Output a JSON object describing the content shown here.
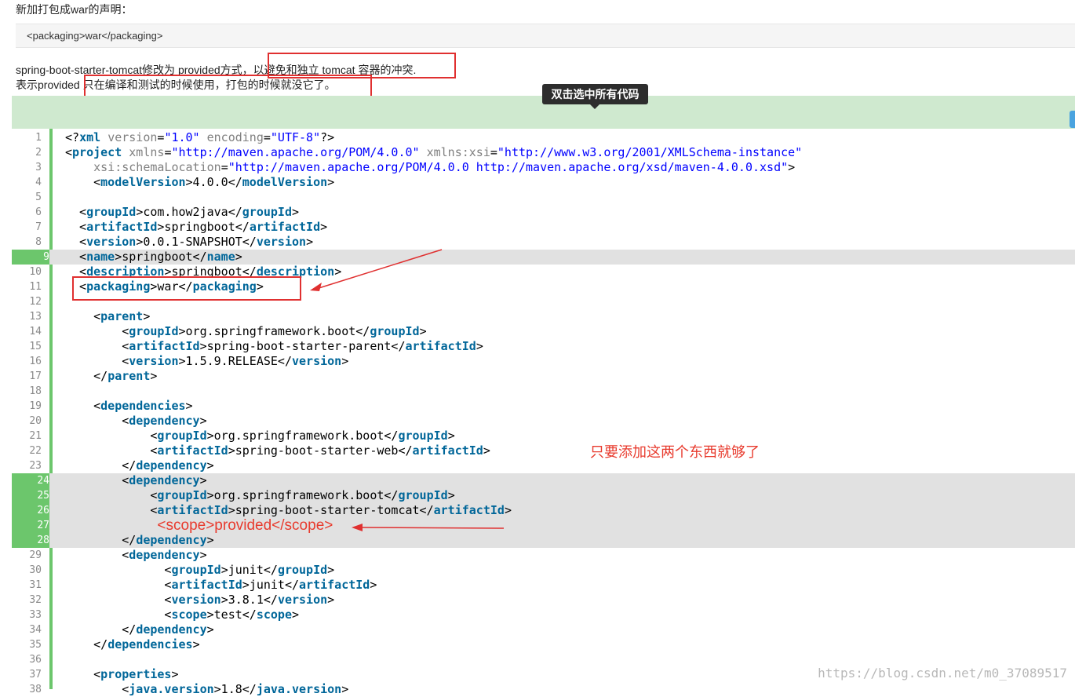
{
  "intro": {
    "heading": "新加打包成war的声明：",
    "snippet": "<packaging>war</packaging>",
    "desc1_prefix": "spring-boot-starter-tomcat修改为 provided方式，",
    "desc1_box": "以避免和独立 tomcat 容器的冲突.",
    "desc2_prefix": "表示provided ",
    "desc2_box": "只在编译和测试的时候使用，打包的时候就没它了。"
  },
  "tooltip": "双击选中所有代码",
  "note": "只要添加这两个东西就够了",
  "watermark": "https://blog.csdn.net/m0_37089517",
  "code": {
    "line_numbers": [
      "1",
      "2",
      "3",
      "4",
      "5",
      "6",
      "7",
      "8",
      "9",
      "10",
      "11",
      "12",
      "13",
      "14",
      "15",
      "16",
      "17",
      "18",
      "19",
      "20",
      "21",
      "22",
      "23",
      "24",
      "25",
      "26",
      "27",
      "28",
      "29",
      "30",
      "31",
      "32",
      "33",
      "34",
      "35",
      "36",
      "37",
      "38"
    ],
    "lines": [
      "<?xml version=\"1.0\" encoding=\"UTF-8\"?>",
      "<project xmlns=\"http://maven.apache.org/POM/4.0.0\" xmlns:xsi=\"http://www.w3.org/2001/XMLSchema-instance\"",
      "    xsi:schemaLocation=\"http://maven.apache.org/POM/4.0.0 http://maven.apache.org/xsd/maven-4.0.0.xsd\">",
      "    <modelVersion>4.0.0</modelVersion>",
      "",
      "  <groupId>com.how2java</groupId>",
      "  <artifactId>springboot</artifactId>",
      "  <version>0.0.1-SNAPSHOT</version>",
      "  <name>springboot</name>",
      "  <description>springboot</description>",
      "  <packaging>war</packaging>",
      "",
      "    <parent>",
      "        <groupId>org.springframework.boot</groupId>",
      "        <artifactId>spring-boot-starter-parent</artifactId>",
      "        <version>1.5.9.RELEASE</version>",
      "    </parent>",
      "",
      "    <dependencies>",
      "        <dependency>",
      "            <groupId>org.springframework.boot</groupId>",
      "            <artifactId>spring-boot-starter-web</artifactId>",
      "        </dependency>",
      "        <dependency>",
      "            <groupId>org.springframework.boot</groupId>",
      "            <artifactId>spring-boot-starter-tomcat</artifactId>",
      "             <scope>provided</scope>",
      "        </dependency>",
      "        <dependency>",
      "              <groupId>junit</groupId>",
      "              <artifactId>junit</artifactId>",
      "              <version>3.8.1</version>",
      "              <scope>test</scope>",
      "        </dependency>",
      "    </dependencies>",
      "",
      "    <properties>",
      "        <java.version>1.8</java.version>"
    ]
  }
}
